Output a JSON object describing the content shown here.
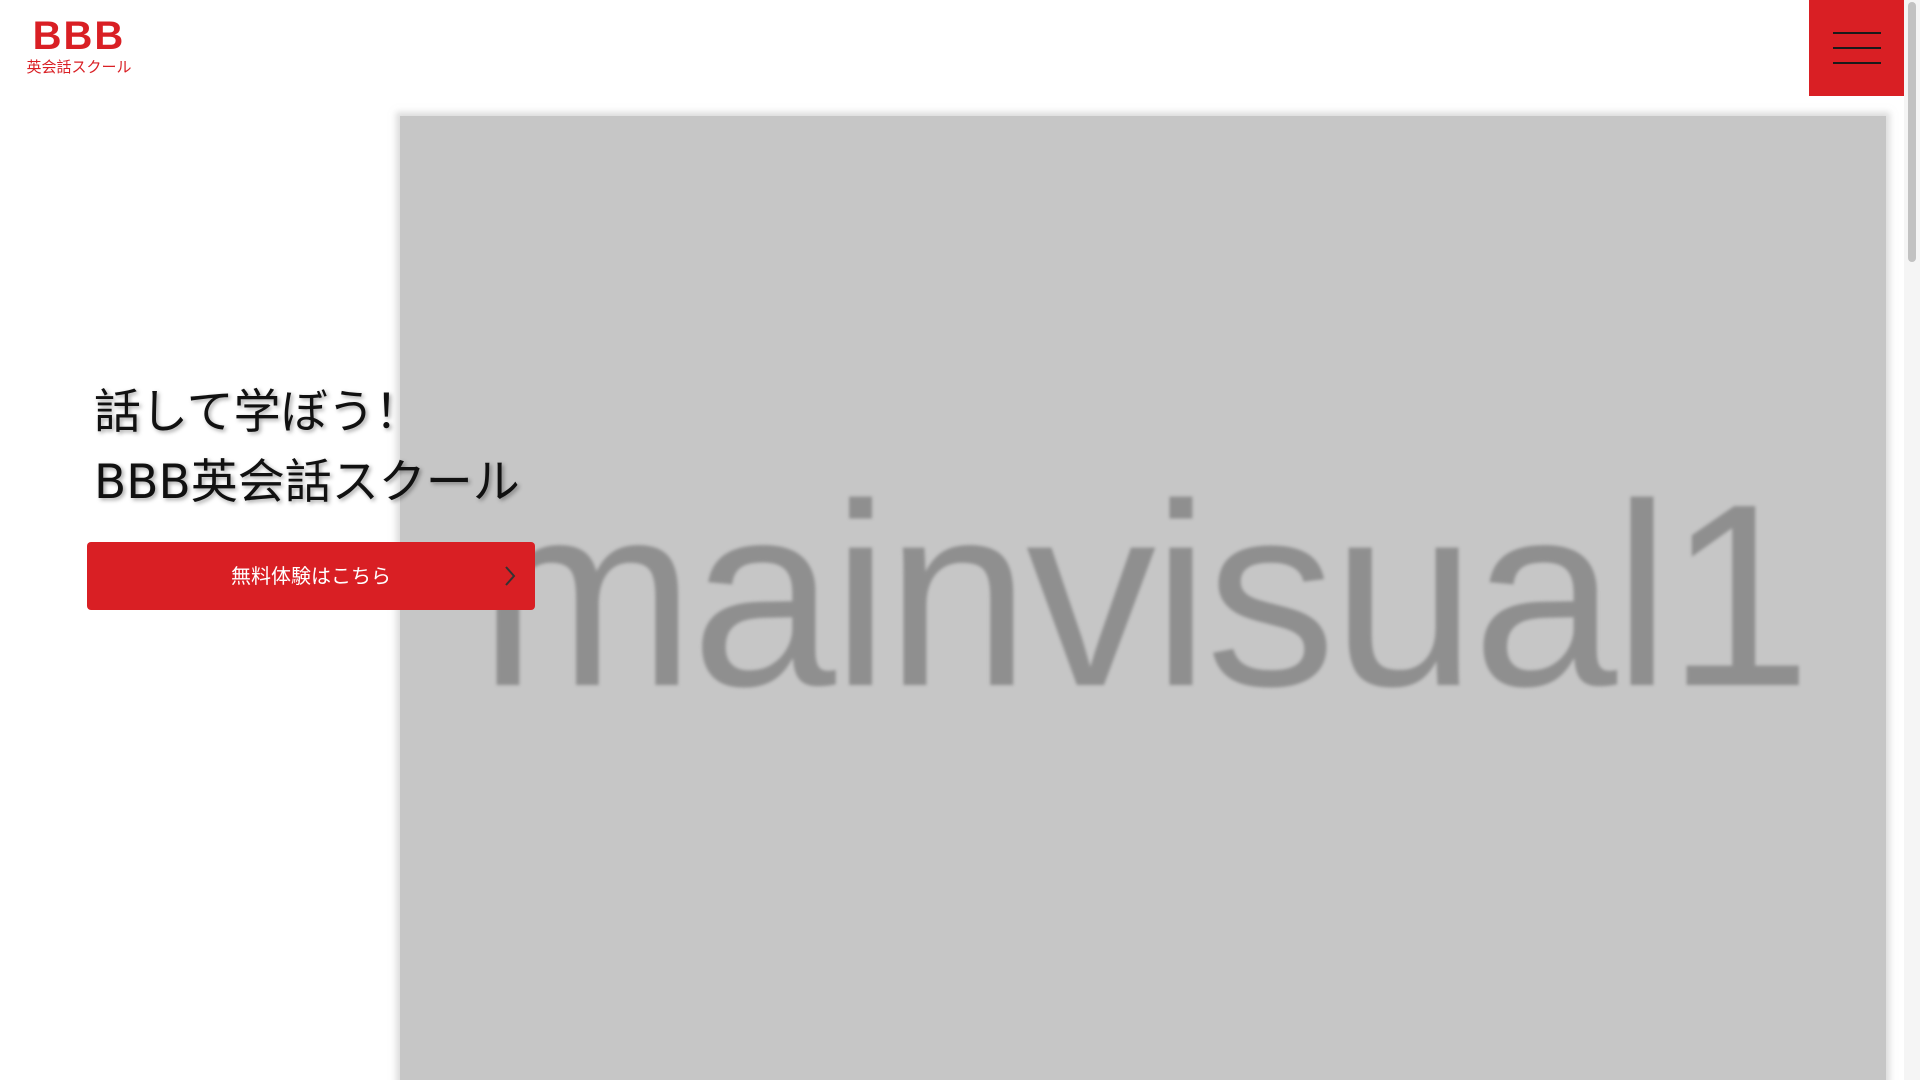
{
  "logo": {
    "mark": "BBB",
    "subtitle": "英会話スクール"
  },
  "menu": {
    "icon": "hamburger-menu-icon"
  },
  "main_visual": {
    "placeholder_text": "mainvisual1"
  },
  "hero": {
    "line1": "話して学ぼう！",
    "line2": "BBB英会話スクール"
  },
  "cta": {
    "label": "無料体験はこちら",
    "icon": "chevron-right-icon"
  },
  "colors": {
    "accent": "#d91f24",
    "placeholder_bg": "#c6c6c6",
    "placeholder_text": "#8f8f8f"
  }
}
